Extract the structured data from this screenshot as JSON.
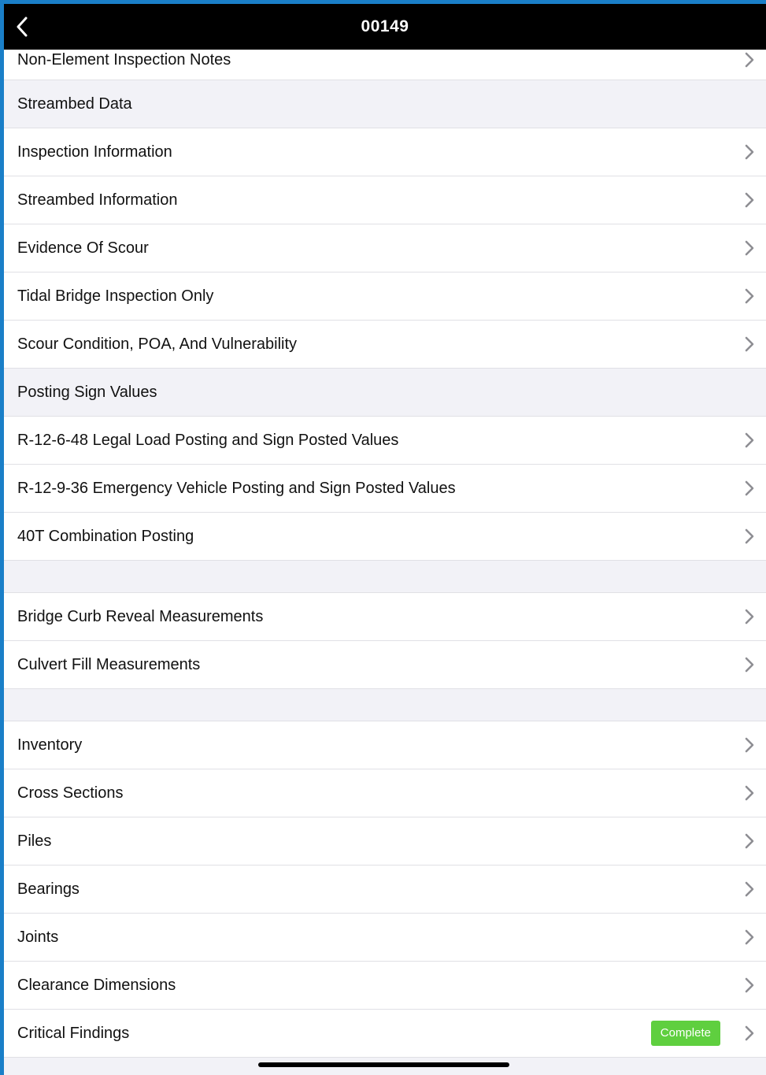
{
  "nav": {
    "title": "00149"
  },
  "colors": {
    "frame_border": "#1a7fc8",
    "navbar_bg": "#000000",
    "section_bg": "#f2f2f7",
    "chevron": "#8e8e93",
    "badge_bg": "#5fcf3f"
  },
  "list": {
    "top_row": {
      "label": "Non-Element Inspection Notes"
    },
    "streambed_header": "Streambed Data",
    "streambed_items": [
      {
        "label": "Inspection Information"
      },
      {
        "label": "Streambed Information"
      },
      {
        "label": "Evidence Of Scour"
      },
      {
        "label": "Tidal Bridge Inspection Only"
      },
      {
        "label": "Scour Condition, POA, And Vulnerability"
      }
    ],
    "posting_header": "Posting Sign Values",
    "posting_items": [
      {
        "label": "R-12-6-48 Legal Load Posting and Sign Posted Values"
      },
      {
        "label": "R-12-9-36 Emergency Vehicle Posting and Sign Posted Values"
      },
      {
        "label": "40T Combination Posting"
      }
    ],
    "measurement_items": [
      {
        "label": "Bridge Curb Reveal Measurements"
      },
      {
        "label": "Culvert Fill Measurements"
      }
    ],
    "other_items": [
      {
        "label": "Inventory"
      },
      {
        "label": "Cross Sections"
      },
      {
        "label": "Piles"
      },
      {
        "label": "Bearings"
      },
      {
        "label": "Joints"
      },
      {
        "label": "Clearance Dimensions"
      },
      {
        "label": "Critical Findings",
        "badge": "Complete"
      }
    ]
  },
  "icons": {
    "back": "chevron-left-icon",
    "disclosure": "chevron-right-icon"
  }
}
